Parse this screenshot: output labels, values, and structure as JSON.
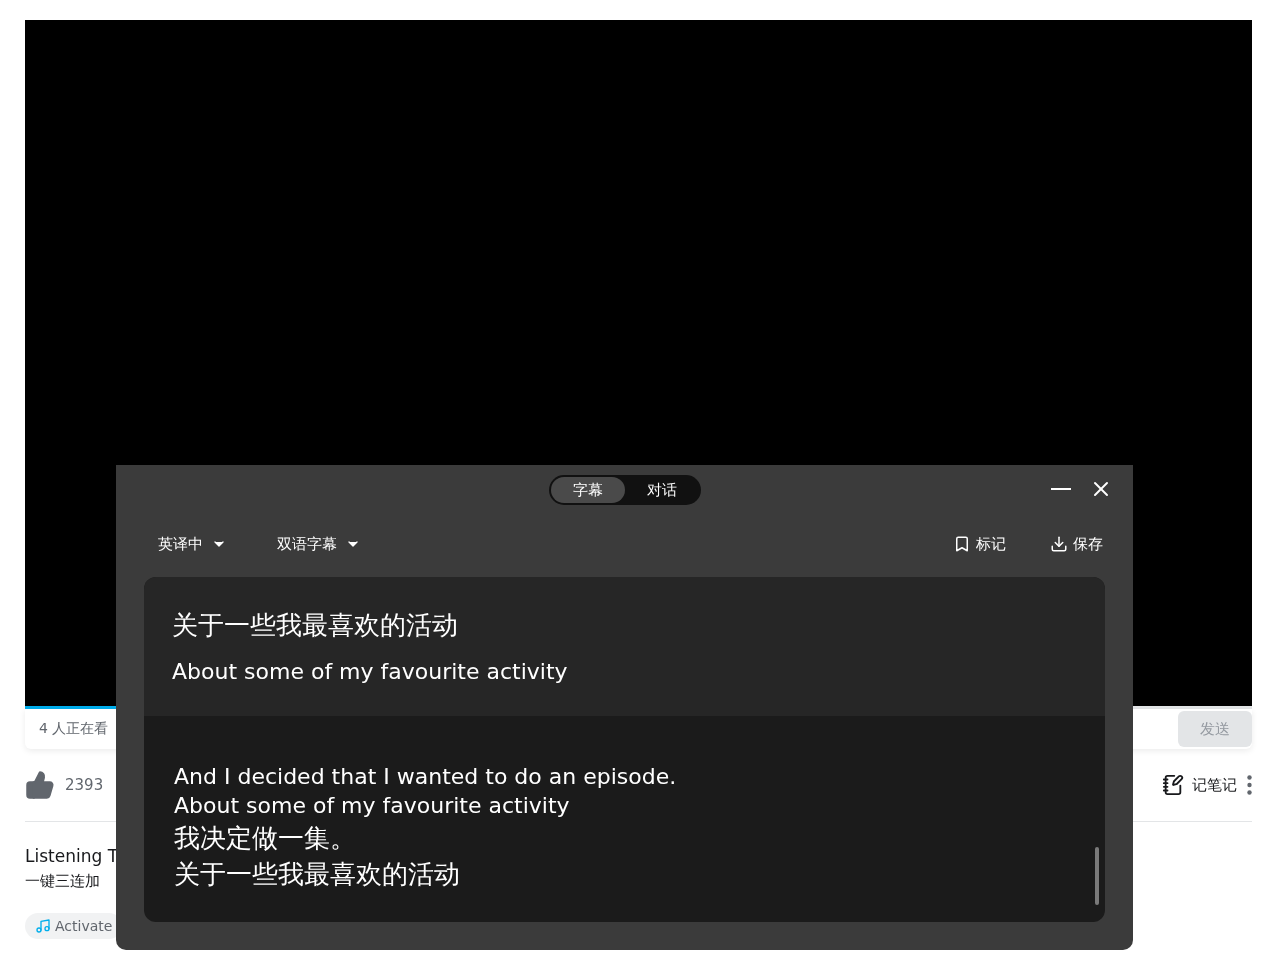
{
  "player": {
    "progress": {
      "level": 0.075
    }
  },
  "danmaku_bar": {
    "viewers": "4 人正在看",
    "send_button": "发送"
  },
  "actions": {
    "likes": "2393",
    "note_button": "记笔记"
  },
  "video_info": {
    "title": "Listening T",
    "description": "一键三连加",
    "tags": [
      {
        "label": "Activate",
        "kind": "music"
      }
    ]
  },
  "subtitle_panel": {
    "tabs": [
      {
        "label": "字幕",
        "selected": true
      },
      {
        "label": "对话",
        "selected": false
      }
    ],
    "language": "英译中",
    "mode": "双语字幕",
    "actions": [
      {
        "label": "标记",
        "kind": "bookmark"
      },
      {
        "label": "保存",
        "kind": "download"
      }
    ],
    "entries": [
      {
        "selected": true,
        "lines": [
          {
            "text": "关于一些我最喜欢的活动",
            "kind": "translation"
          },
          {
            "text": "About some of my favourite activity",
            "kind": "original"
          }
        ]
      },
      {
        "selected": false,
        "lines": [
          {
            "text": "And I decided that I wanted to do an episode.",
            "kind": "original"
          },
          {
            "text": "About some of my favourite activity",
            "kind": "original"
          },
          {
            "text": "我决定做一集。",
            "kind": "translation"
          },
          {
            "text": "关于一些我最喜欢的活动",
            "kind": "translation"
          }
        ]
      }
    ]
  }
}
